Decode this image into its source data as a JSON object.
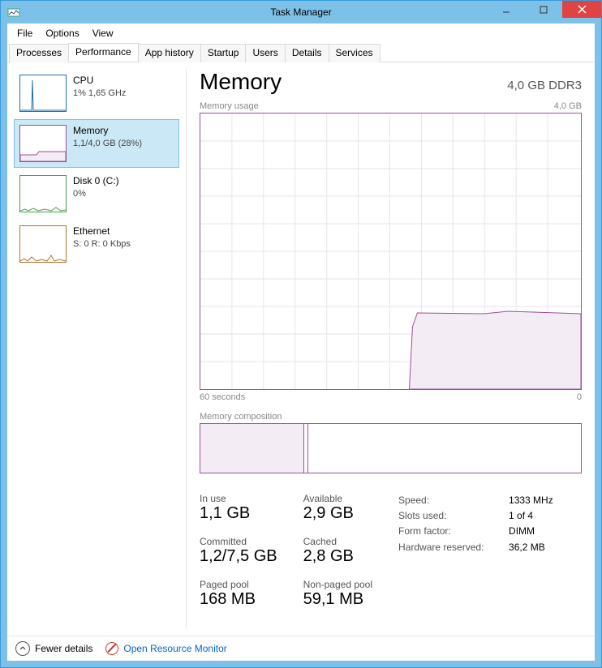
{
  "window_title": "Task Manager",
  "menu": {
    "file": "File",
    "options": "Options",
    "view": "View"
  },
  "tabs": {
    "processes": "Processes",
    "performance": "Performance",
    "app_history": "App history",
    "startup": "Startup",
    "users": "Users",
    "details": "Details",
    "services": "Services"
  },
  "side": {
    "cpu": {
      "name": "CPU",
      "sub": "1% 1,65 GHz"
    },
    "memory": {
      "name": "Memory",
      "sub": "1,1/4,0 GB (28%)"
    },
    "disk": {
      "name": "Disk 0 (C:)",
      "sub": "0%"
    },
    "ethernet": {
      "name": "Ethernet",
      "sub": "S: 0 R: 0 Kbps"
    }
  },
  "page": {
    "title": "Memory",
    "total": "4,0 GB DDR3",
    "usage_label": "Memory usage",
    "usage_max": "4,0 GB",
    "x_left": "60 seconds",
    "x_right": "0",
    "composition_label": "Memory composition"
  },
  "stats": {
    "in_use": {
      "label": "In use",
      "value": "1,1 GB"
    },
    "available": {
      "label": "Available",
      "value": "2,9 GB"
    },
    "committed": {
      "label": "Committed",
      "value": "1,2/7,5 GB"
    },
    "cached": {
      "label": "Cached",
      "value": "2,8 GB"
    },
    "paged": {
      "label": "Paged pool",
      "value": "168 MB"
    },
    "nonpaged": {
      "label": "Non-paged pool",
      "value": "59,1 MB"
    }
  },
  "kv": {
    "speed": {
      "k": "Speed:",
      "v": "1333 MHz"
    },
    "slots": {
      "k": "Slots used:",
      "v": "1 of 4"
    },
    "form": {
      "k": "Form factor:",
      "v": "DIMM"
    },
    "hw": {
      "k": "Hardware reserved:",
      "v": "36,2 MB"
    }
  },
  "footer": {
    "fewer": "Fewer details",
    "resmon": "Open Resource Monitor"
  },
  "chart_data": {
    "type": "area",
    "title": "Memory usage",
    "ylabel": "GB",
    "ylim": [
      0,
      4.0
    ],
    "xlabel": "seconds",
    "xlim": [
      60,
      0
    ],
    "series": [
      {
        "name": "Memory usage (GB)",
        "x": [
          60,
          27,
          26.5,
          26,
          0
        ],
        "values": [
          0,
          0,
          0.9,
          1.1,
          1.1
        ]
      }
    ]
  }
}
